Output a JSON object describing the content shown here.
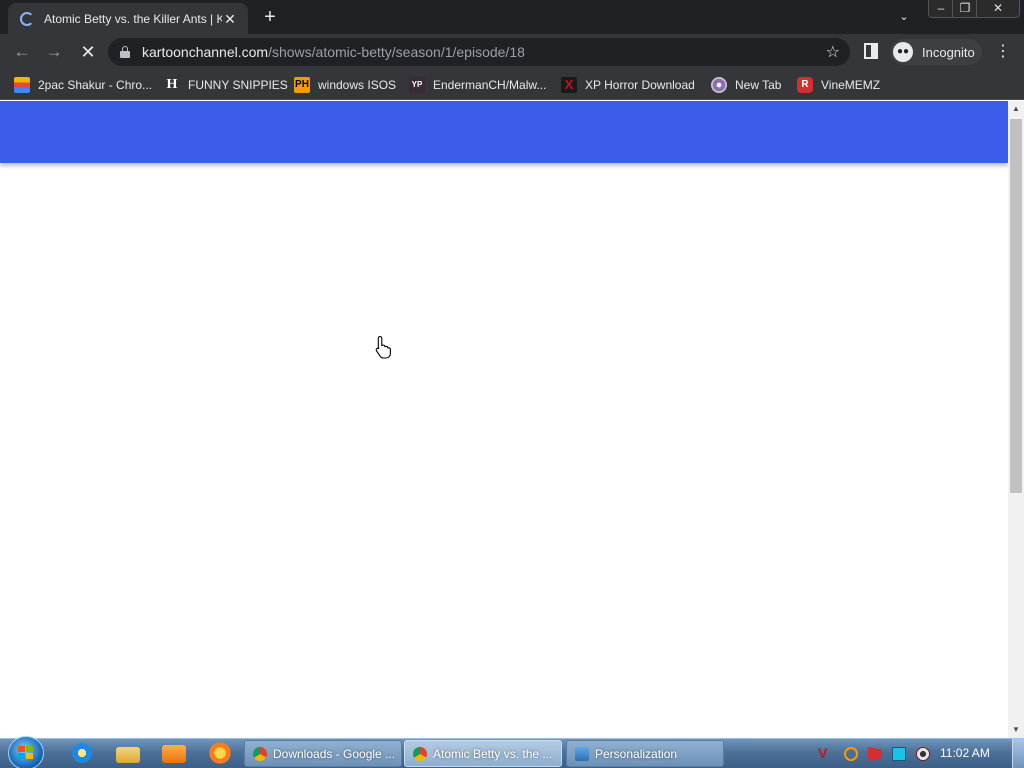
{
  "browser": {
    "tab": {
      "title": "Atomic Betty vs. the Killer Ants | Kar",
      "close_icon": "close-icon"
    },
    "new_tab_label": "+",
    "tab_search_glyph": "⌄",
    "window_controls": {
      "minimize": "–",
      "maximize": "❐",
      "close": "✕"
    },
    "nav": {
      "back": "←",
      "forward": "→",
      "stop": "✕"
    },
    "address": {
      "host": "kartoonchannel.com",
      "path": "/shows/atomic-betty/season/1/episode/18"
    },
    "star_glyph": "☆",
    "incognito_label": "Incognito",
    "menu_glyph": "⋮",
    "bookmarks": [
      {
        "label": "2pac Shakur - Chro...",
        "icon": "photo-icon",
        "color": "#e24b3c"
      },
      {
        "label": "FUNNY SNIPPIES",
        "icon": "h-logo-icon",
        "glyph": "H",
        "color": "#ffffff"
      },
      {
        "label": "windows ISOS",
        "icon": "ph-logo-icon",
        "glyph": "PH",
        "color": "#f59b00"
      },
      {
        "label": "EndermanCH/Malw...",
        "icon": "yp-logo-icon",
        "glyph": "YP",
        "color": "#3a2a3a"
      },
      {
        "label": "XP Horror Download",
        "icon": "x-logo-icon",
        "glyph": "X",
        "color": "#c4161c"
      },
      {
        "label": "New Tab",
        "icon": "globe-icon",
        "color": "#8a6fb0"
      },
      {
        "label": "VineMEMZ",
        "icon": "r-logo-icon",
        "glyph": "R",
        "color": "#d32f2f"
      }
    ]
  },
  "page": {
    "header_color": "#3b5de7"
  },
  "taskbar": {
    "tasks": [
      {
        "label": "Downloads - Google ...",
        "icon": "chrome-icon",
        "active": false
      },
      {
        "label": "Atomic Betty vs. the ...",
        "icon": "chrome-icon",
        "active": true
      },
      {
        "label": "Personalization",
        "icon": "personalization-icon",
        "active": false
      }
    ],
    "clock": "11:02 AM"
  }
}
